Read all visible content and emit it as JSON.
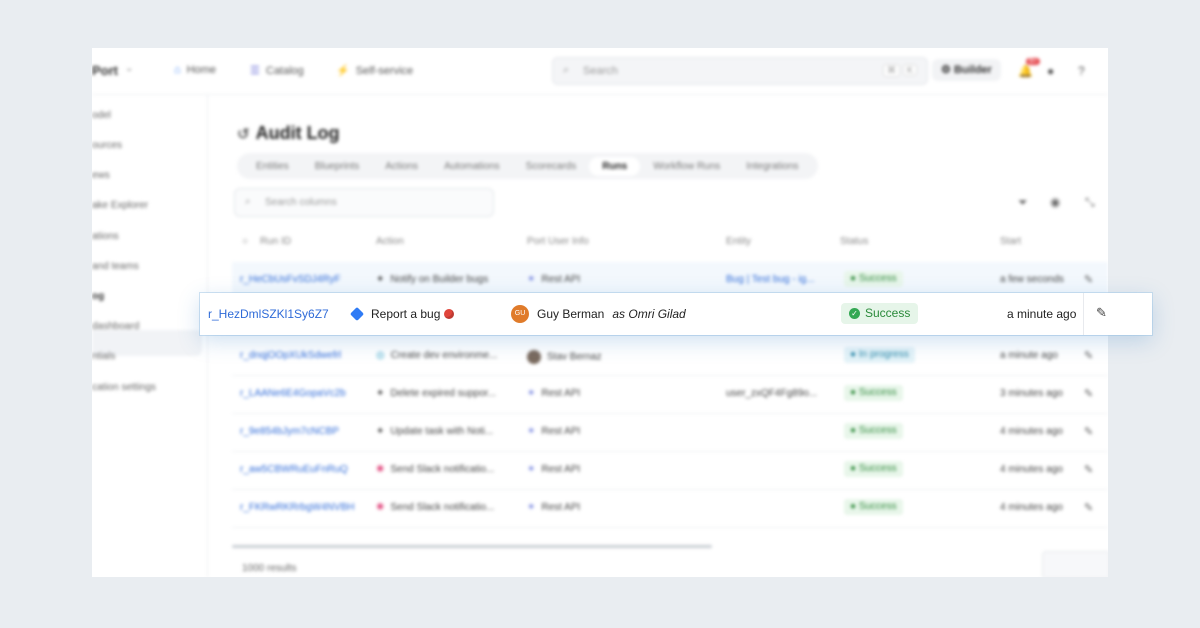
{
  "topbar": {
    "brand": "Port",
    "nav": [
      {
        "label": "Home",
        "icon": "home-icon",
        "glyph": "⌂",
        "color": "#3b82f6"
      },
      {
        "label": "Catalog",
        "icon": "catalog-icon",
        "glyph": "☰",
        "color": "#6b6fd8"
      },
      {
        "label": "Self-service",
        "icon": "lightning-icon",
        "glyph": "⚡",
        "color": "#f5b400"
      }
    ],
    "search_placeholder": "Search",
    "search_key1": "⌘",
    "search_key2": "K",
    "builder_label": "Builder",
    "notif_count": "9+"
  },
  "sidebar": {
    "items": [
      "odel",
      "ources",
      "ews",
      "ake Explorer",
      "ations",
      "and teams",
      "og",
      "dashboard",
      "ntials",
      "cation settings"
    ]
  },
  "page": {
    "title": "Audit Log",
    "tabs": [
      "Entities",
      "Blueprints",
      "Actions",
      "Automations",
      "Scorecards",
      "Runs",
      "Workflow Runs",
      "Integrations"
    ],
    "active_tab": "Runs",
    "col_search_placeholder": "Search columns",
    "footer": "1000 results"
  },
  "table": {
    "headers": [
      "Run ID",
      "Action",
      "Port User Info",
      "Entity",
      "Status",
      "Start"
    ],
    "rows": [
      {
        "id": "r_HeCbUsFvSDJ4RyF",
        "action": "Notify on Builder bugs",
        "action_icon": "✦",
        "user": "Rest API",
        "user_icon": "star",
        "entity": "Bug | Test bug - ig...",
        "status": "Success",
        "status_kind": "success",
        "start": "a few seconds"
      },
      {
        "id": "r_dnqjOOpXUkSdwefrl",
        "action": "Create dev environme...",
        "action_icon": "◎",
        "user": "Stav Bernaz",
        "user_icon": "avatar",
        "entity": "",
        "status": "In progress",
        "status_kind": "progress",
        "start": "a minute ago"
      },
      {
        "id": "r_LAANe6E4GopaVc2b",
        "action": "Delete expired suppor...",
        "action_icon": "✦",
        "user": "Rest API",
        "user_icon": "star",
        "entity": "user_zxQF4Fg89o...",
        "status": "Success",
        "status_kind": "success",
        "start": "3 minutes ago"
      },
      {
        "id": "r_9e854bJym7cNCBP",
        "action": "Update task with Noti...",
        "action_icon": "✦",
        "user": "Rest API",
        "user_icon": "star",
        "entity": "",
        "status": "Success",
        "status_kind": "success",
        "start": "4 minutes ago"
      },
      {
        "id": "r_aw5CBWRuEuFnRuQ",
        "action": "Send Slack notificatio...",
        "action_icon": "✺",
        "user": "Rest API",
        "user_icon": "star",
        "entity": "",
        "status": "Success",
        "status_kind": "success",
        "start": "4 minutes ago"
      },
      {
        "id": "r_FKRwRKRrbgW4NVBH",
        "action": "Send Slack notificatio...",
        "action_icon": "✺",
        "user": "Rest API",
        "user_icon": "star",
        "entity": "",
        "status": "Success",
        "status_kind": "success",
        "start": "4 minutes ago"
      }
    ]
  },
  "highlight": {
    "id": "r_HezDmlSZKl1Sy6Z7",
    "action": "Report a bug",
    "avatar_initials": "GU",
    "user": "Guy Berman",
    "as_user": "as Omri Gilad",
    "status": "Success",
    "start": "a minute ago"
  },
  "colors": {
    "accent": "#2f6bd8",
    "success": "#34a853",
    "badge": "#e5484d"
  }
}
